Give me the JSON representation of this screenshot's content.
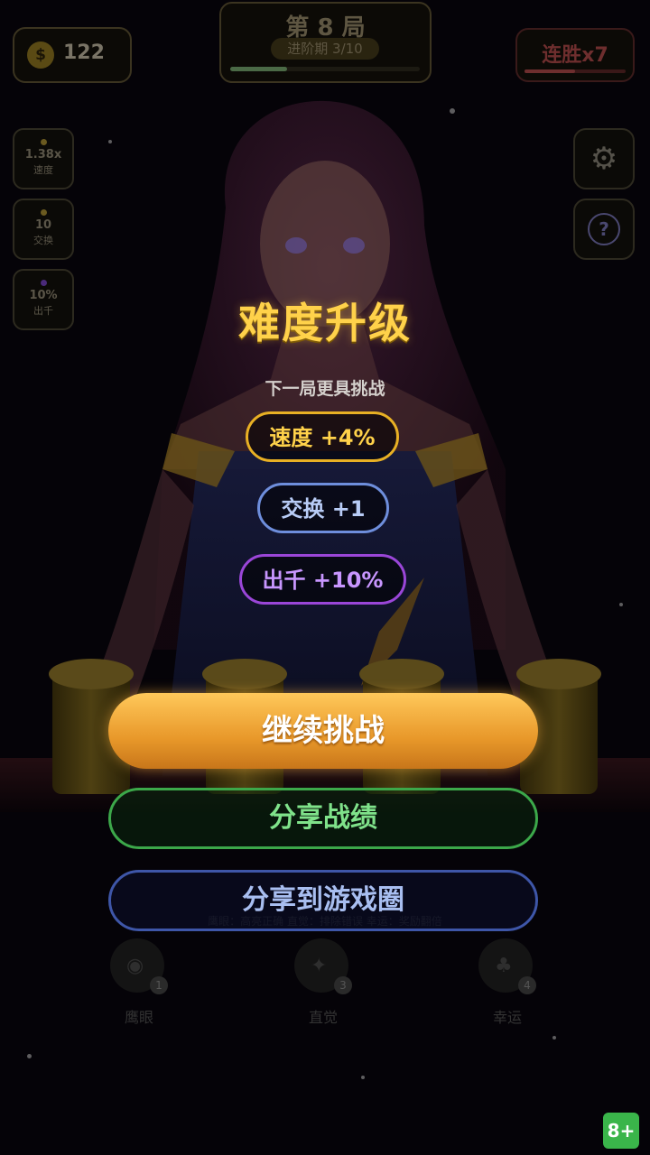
{
  "hud": {
    "coins": "122",
    "coin_symbol": "$",
    "round_title": "第 8 局",
    "round_stage": "进阶期 3/10",
    "round_progress": 0.3,
    "streak": "连胜x7",
    "streak_progress": 0.5
  },
  "stats": [
    {
      "value": "1.38x",
      "label": "速度"
    },
    {
      "value": "10",
      "label": "交换"
    },
    {
      "value": "10%",
      "label": "出千"
    }
  ],
  "side_buttons": {
    "settings_icon": "gear-icon",
    "help_icon": "?"
  },
  "skills": {
    "hint": "鹰眼：高亮正确    直觉：排除错误    幸运：奖励翻倍",
    "items": [
      {
        "name": "鹰眼",
        "count": "1",
        "icon": "eye-icon"
      },
      {
        "name": "直觉",
        "count": "3",
        "icon": "intuition-icon"
      },
      {
        "name": "幸运",
        "count": "4",
        "icon": "luck-icon"
      }
    ]
  },
  "modal": {
    "title": "难度升级",
    "subtitle": "下一局更具挑战",
    "speed": "速度 +4%",
    "swaps": "交换 +1",
    "cheat": "出千 +10%",
    "continue_label": "继续挑战",
    "share_label": "分享战绩",
    "share_circle_label": "分享到游戏圈"
  },
  "age_rating": "8+",
  "colors": {
    "title_gold": "#ffd24a",
    "speed_pill": "#e8b024",
    "swap_pill": "#6e8edc",
    "cheat_pill": "#9a46d8",
    "share_green": "#3ca84a",
    "circle_blue": "#3e56a8",
    "age_green": "#3ab54a"
  }
}
